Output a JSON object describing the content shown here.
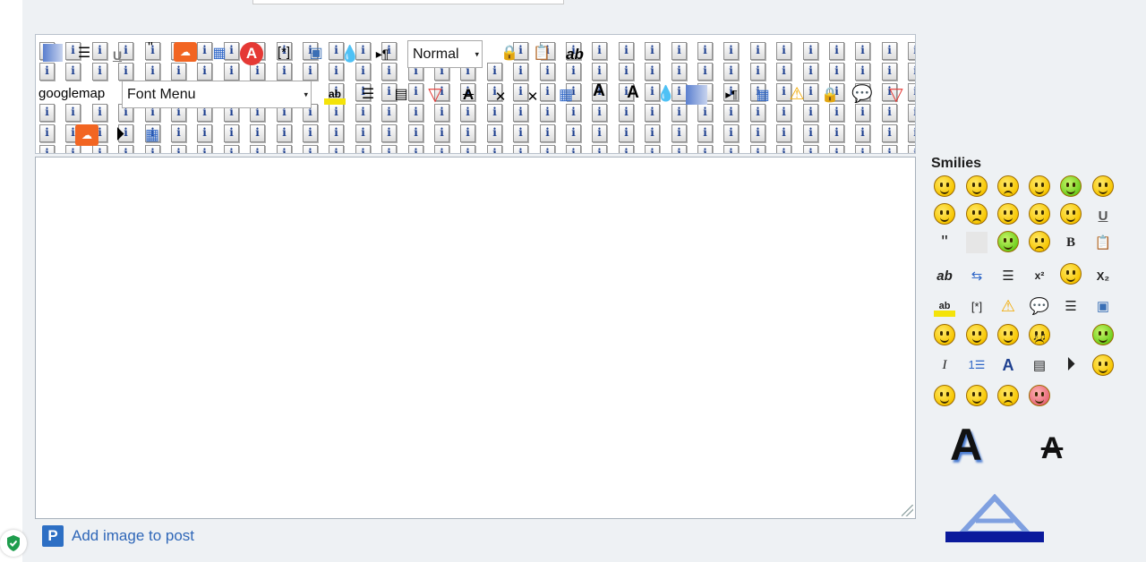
{
  "toolbar": {
    "label_googlemap": "googlemap",
    "format_select_value": "Normal",
    "font_select_value": "Font Menu",
    "format_dropdown_arrow": "▾",
    "font_dropdown_arrow": "▾",
    "text_ab": "ab",
    "text_ab_small": "ab",
    "text_bracket": "[*]",
    "text_A": "A"
  },
  "post": {
    "add_image_label": "Add image to post",
    "add_image_icon_letter": "P"
  },
  "smilies": {
    "title": "Smilies",
    "text_items": {
      "underline": "U",
      "bold": "B",
      "italic": "I",
      "quote": "\"",
      "ab": "ab",
      "superscript": "x²",
      "subscript": "X₂",
      "list_number": "1☰",
      "bracket": "[*]"
    }
  },
  "colors": {
    "accent_link": "#2f67b8",
    "info_icon_blue": "#1d3f8f",
    "smiley_yellow": "#f7c600",
    "shield_green": "#1f9d4d"
  }
}
